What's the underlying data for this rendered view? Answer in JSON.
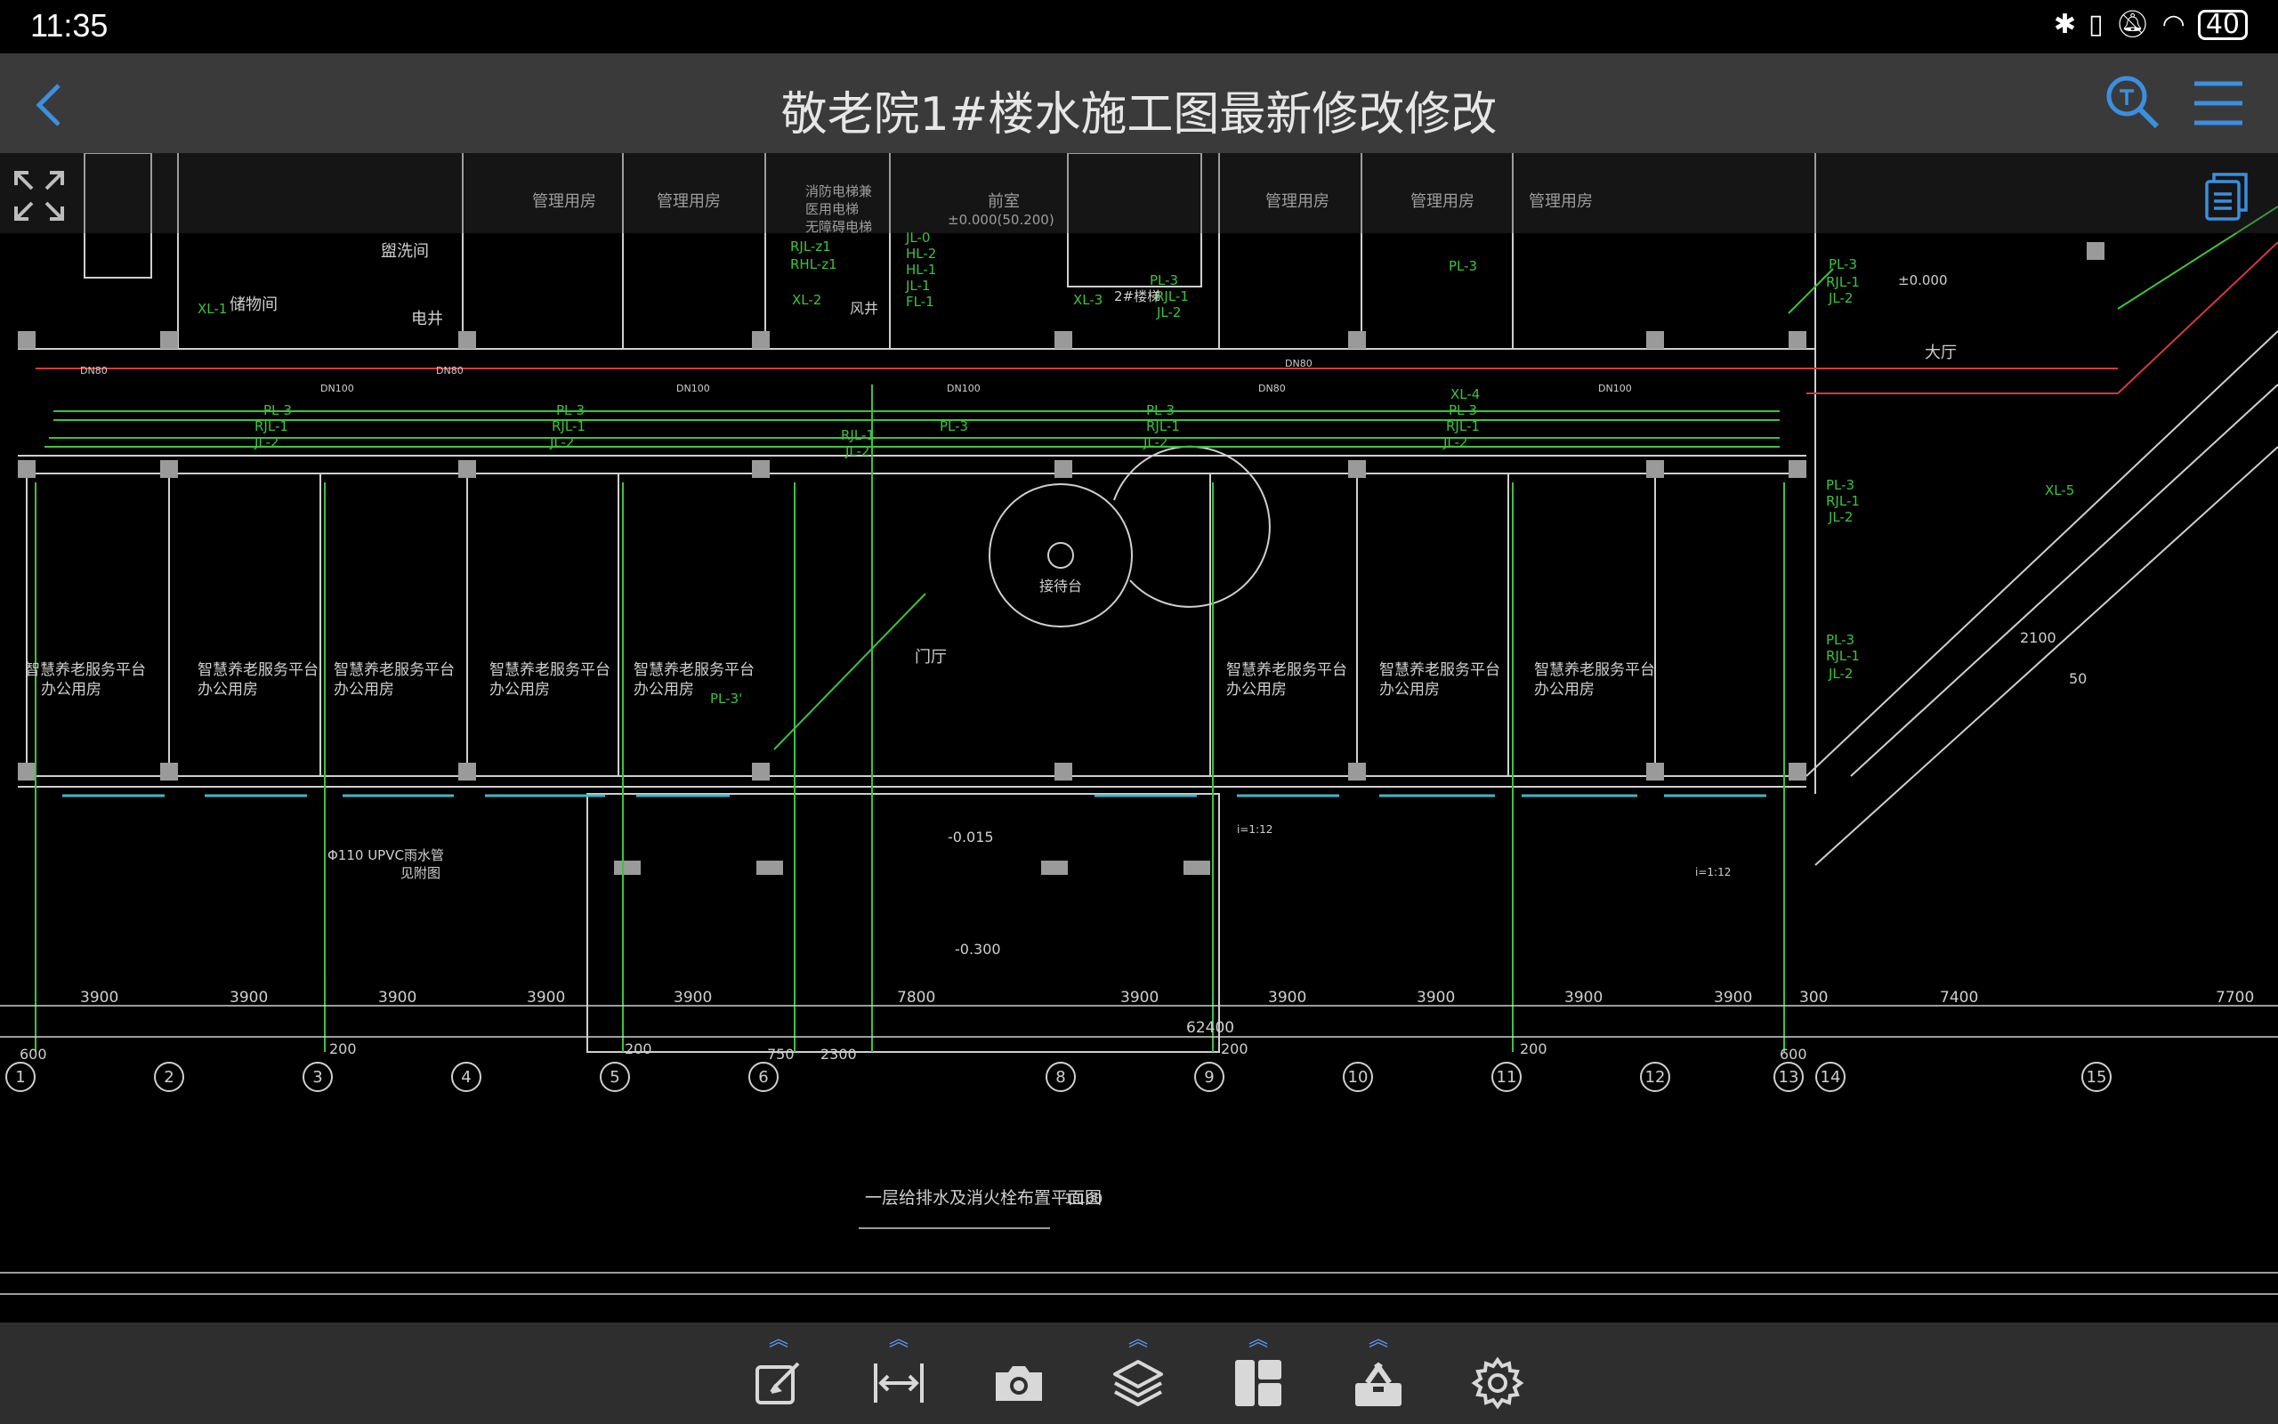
{
  "status_bar": {
    "time": "11:35",
    "battery": "40"
  },
  "header": {
    "title": "敬老院1#楼水施工图最新修改修改"
  },
  "drawing": {
    "top_rooms": [
      "管理用房",
      "管理用房",
      "管理用房",
      "管理用房",
      "管理用房"
    ],
    "top_small_labels": [
      "盥洗间",
      "储物间",
      "电井",
      "消防电梯兼",
      "医用电梯",
      "无障碍电梯",
      "前室",
      "风井",
      "大厅"
    ],
    "elevation_top": "±0.000(50.200)",
    "elevation_right": "±0.000",
    "pipe_tags": [
      "JL-0",
      "HL-2",
      "HL-1",
      "JL-1",
      "FL-1",
      "RJL-z1",
      "RHL-z1",
      "XL-2",
      "XL-1",
      "XL-3",
      "PL-3",
      "RJL-1",
      "JL-2",
      "XL-4",
      "XL-5",
      "PL-3'",
      "2#楼梯"
    ],
    "office_label_a": "智慧养老服务平台",
    "office_label_b": "办公用房",
    "lobby": "门厅",
    "reception": "接待台",
    "dn_labels": [
      "DN80",
      "DN100",
      "DN80",
      "DN100",
      "DN100",
      "DN80",
      "DN100",
      "DN80"
    ],
    "pipe_note_1": "Φ110 UPVC雨水管",
    "pipe_note_2": "见附图",
    "level_1": "-0.015",
    "level_2": "-0.300",
    "slope_1": "i=1:12",
    "slope_2": "i=1:12",
    "dims": [
      "3900",
      "3900",
      "3900",
      "3900",
      "3900",
      "7800",
      "3900",
      "3900",
      "3900",
      "3900",
      "3900",
      "300",
      "7400",
      "7700"
    ],
    "total_dim": "62400",
    "small_dims": [
      "600",
      "200",
      "200",
      "750",
      "2300",
      "200",
      "200",
      "600"
    ],
    "diag_dims": [
      "2100",
      "50"
    ],
    "axis_numbers": [
      "1",
      "2",
      "3",
      "4",
      "5",
      "6",
      "8",
      "9",
      "10",
      "11",
      "12",
      "13",
      "14",
      "15"
    ],
    "caption": "一层给排水及消火栓布置平面图",
    "scale": "1:100"
  },
  "colors": {
    "wall": "#cfcfcf",
    "water_pipe": "#3cc43c",
    "fire_pipe": "#d43a3a",
    "accent": "#3b8fe0",
    "toolbar_bg": "#2e2e2e",
    "title_bg": "#3a3a3a"
  },
  "toolbar": {
    "icons": [
      "edit-icon",
      "measure-icon",
      "camera-icon",
      "layers-icon",
      "layout-icon",
      "toolbox-icon",
      "settings-icon"
    ]
  }
}
